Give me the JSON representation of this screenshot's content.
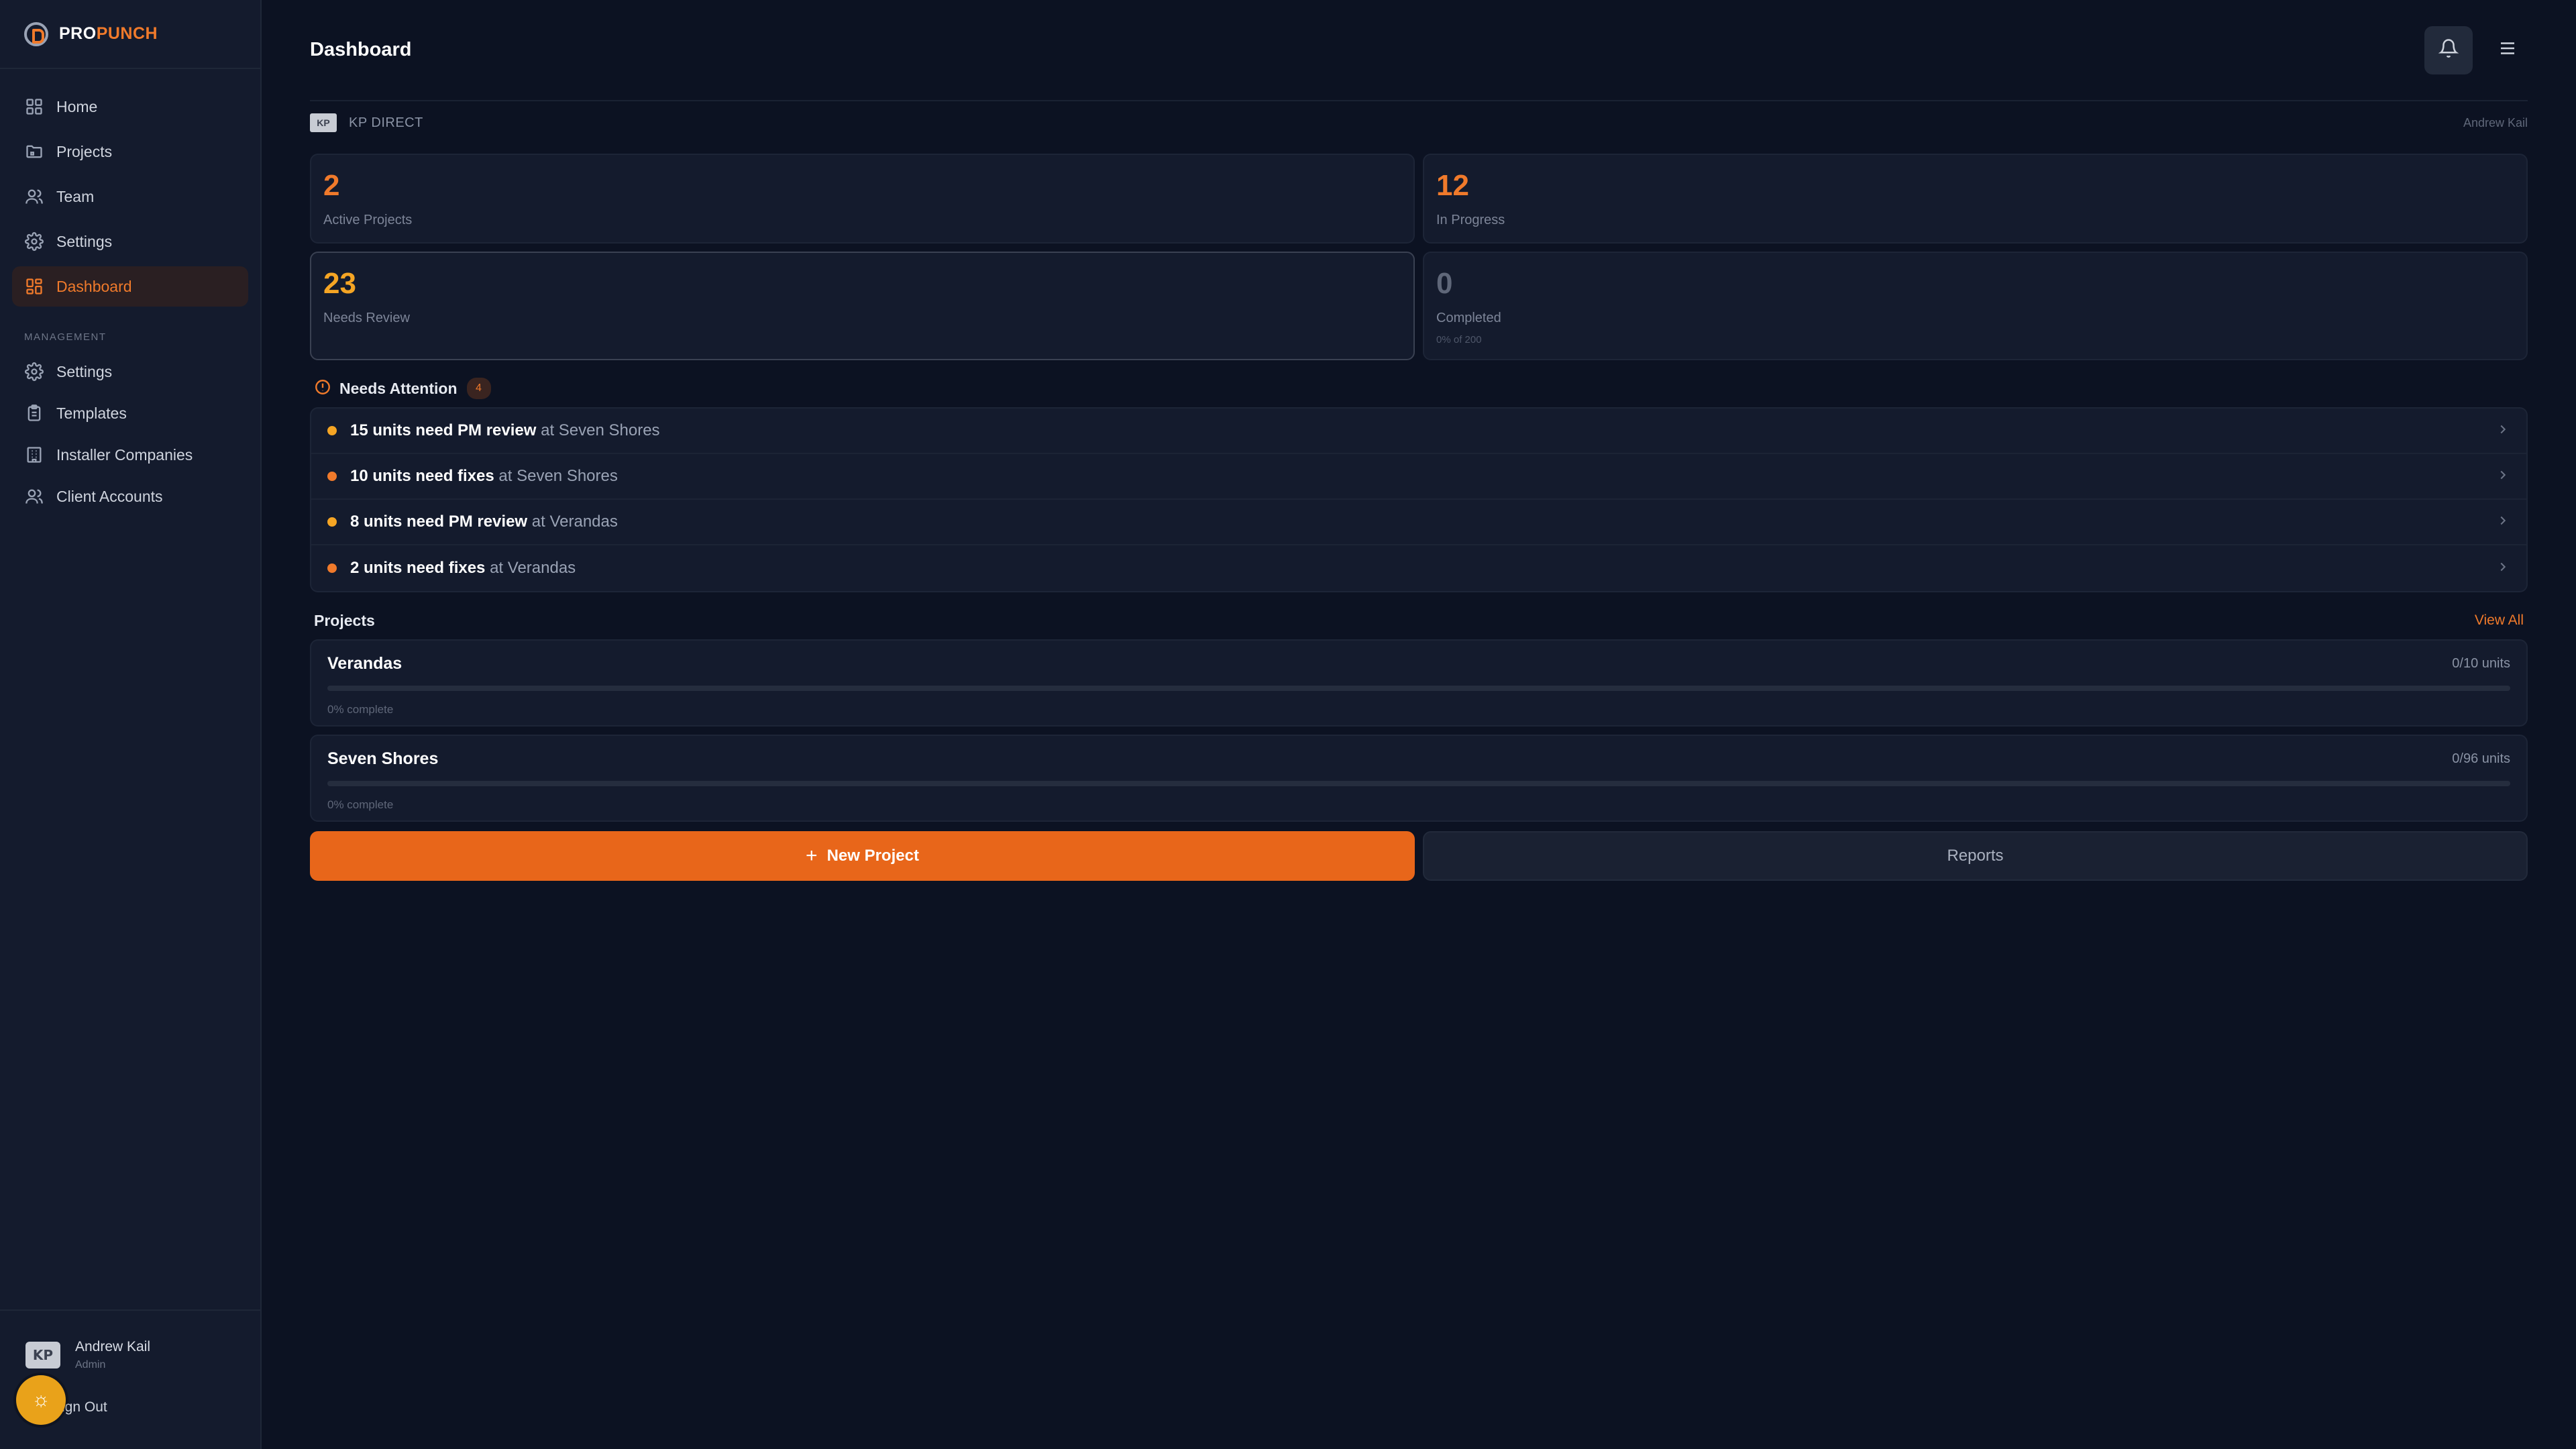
{
  "brand": {
    "pro": "PRO",
    "punch": "PUNCH"
  },
  "sidebar": {
    "nav": [
      {
        "label": "Home",
        "icon": "grid-icon"
      },
      {
        "label": "Projects",
        "icon": "folder-icon"
      },
      {
        "label": "Team",
        "icon": "users-icon"
      },
      {
        "label": "Settings",
        "icon": "gear-icon"
      },
      {
        "label": "Dashboard",
        "icon": "dashboard-icon",
        "active": true
      }
    ],
    "management_label": "MANAGEMENT",
    "management": [
      {
        "label": "Settings",
        "icon": "gear-icon"
      },
      {
        "label": "Templates",
        "icon": "clipboard-icon"
      },
      {
        "label": "Installer Companies",
        "icon": "building-icon"
      },
      {
        "label": "Client Accounts",
        "icon": "users-icon"
      }
    ],
    "user": {
      "initials": "KP",
      "name": "Andrew Kail",
      "role": "Admin"
    },
    "signout": "Sign Out"
  },
  "header": {
    "title": "Dashboard"
  },
  "company": {
    "logo": "KP",
    "name": "KP DIRECT",
    "user": "Andrew Kail"
  },
  "stats": [
    {
      "value": "2",
      "label": "Active Projects"
    },
    {
      "value": "12",
      "label": "In Progress"
    },
    {
      "value": "23",
      "label": "Needs Review"
    },
    {
      "value": "0",
      "label": "Completed",
      "sub": "0% of 200"
    }
  ],
  "attention": {
    "title": "Needs Attention",
    "count": "4",
    "items": [
      {
        "bold": "15 units need PM review",
        "rest": " at Seven Shores"
      },
      {
        "bold": "10 units need fixes",
        "rest": " at Seven Shores"
      },
      {
        "bold": "8 units need PM review",
        "rest": " at Verandas"
      },
      {
        "bold": "2 units need fixes",
        "rest": " at Verandas"
      }
    ]
  },
  "projects": {
    "title": "Projects",
    "view_all": "View All",
    "items": [
      {
        "name": "Verandas",
        "units": "0/10 units",
        "progress": 0,
        "complete": "0% complete"
      },
      {
        "name": "Seven Shores",
        "units": "0/96 units",
        "progress": 0,
        "complete": "0% complete"
      }
    ]
  },
  "actions": {
    "new_project": "New Project",
    "reports": "Reports"
  },
  "colors": {
    "accent": "#f07a2b",
    "amber": "#f5a524",
    "background": "#0c1222"
  }
}
